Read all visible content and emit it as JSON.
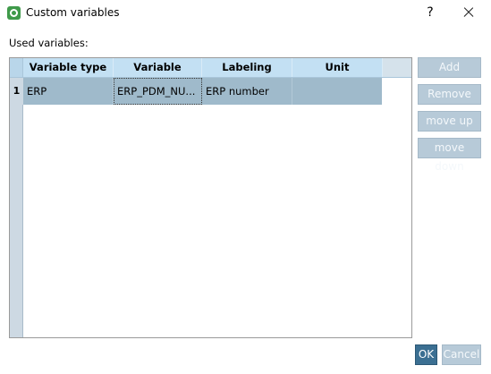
{
  "window": {
    "title": "Custom variables",
    "help_label": "?",
    "accent_color": "#3b6f92",
    "icon_color": "#3f9a4a"
  },
  "main": {
    "used_label": "Used variables:"
  },
  "table": {
    "headers": [
      "Variable type",
      "Variable",
      "Labeling",
      "Unit"
    ],
    "rows": [
      {
        "num": "1",
        "variable_type": "ERP",
        "variable": "ERP_PDM_NU...",
        "labeling": "ERP number",
        "unit": ""
      }
    ]
  },
  "buttons": {
    "add": "Add",
    "remove": "Remove",
    "move_up": "move up",
    "move_down": "move down",
    "ok": "OK",
    "cancel": "Cancel"
  }
}
